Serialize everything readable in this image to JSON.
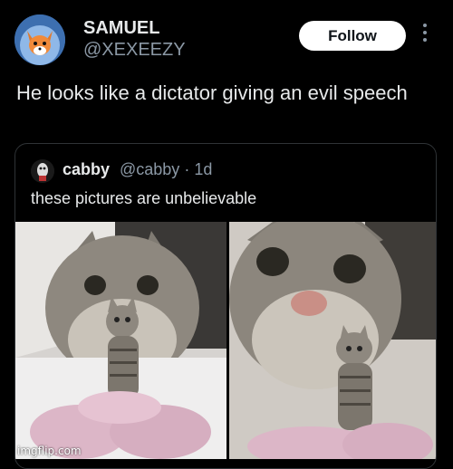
{
  "tweet": {
    "author_name": "SAMUEL",
    "author_handle": "@XEXEEZY",
    "follow_label": "Follow",
    "more_icon": "more-vertical-icon",
    "text": "He looks like a dictator giving an evil speech"
  },
  "quote": {
    "author_name": "cabby",
    "author_handle": "@cabby",
    "time": "· 1d",
    "text": "these pictures are unbelievable"
  },
  "watermark": "imgflip.com",
  "colors": {
    "background": "#000000",
    "text": "#e7e9ea",
    "secondary_text": "#8b98a5",
    "button_bg": "#ffffff",
    "border": "#2f3336"
  }
}
